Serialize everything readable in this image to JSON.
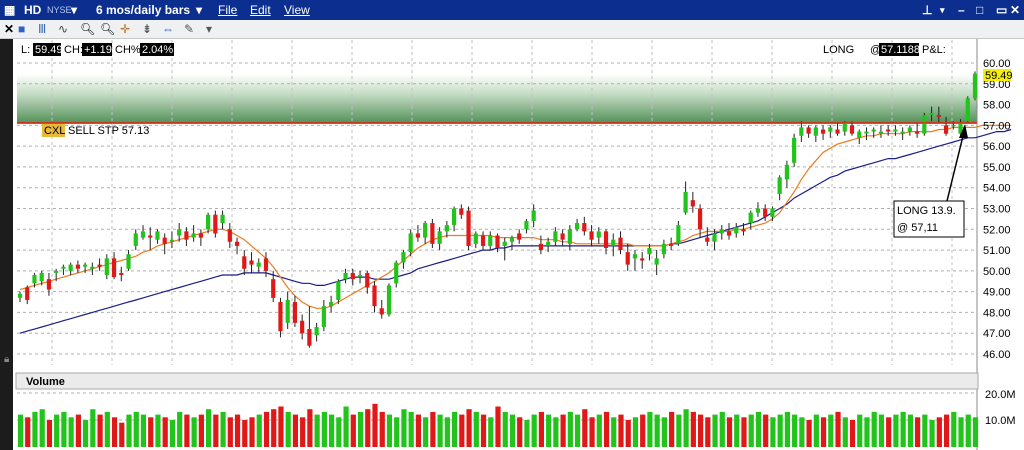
{
  "window": {
    "symbol": "HD",
    "exchange": "NYSE",
    "period": "6 mos/daily bars",
    "menu": [
      "File",
      "Edit",
      "View"
    ],
    "title_icon": "chart-window-icon",
    "controls": [
      "pin-icon",
      "minimize-icon",
      "maximize-icon",
      "close-icon"
    ]
  },
  "toolbar": {
    "icons": [
      "close-icon",
      "info-icon",
      "bar-chart-icon",
      "trend-icon",
      "zoom-in-icon",
      "zoom-out-icon",
      "crosshair-icon",
      "cursor-icon",
      "scroll-icon",
      "wrench-icon",
      "dropdown-icon"
    ]
  },
  "info_bar": {
    "l_label": "L:",
    "l_value": "59.49",
    "ch_label": "CH:",
    "ch_value": "+1.19",
    "chp_label": "CH%:",
    "chp_value": "2.04%",
    "position": "LONG",
    "at_label": "@",
    "avg_price": "57.1188",
    "pl_label": "P&L:"
  },
  "order": {
    "tag": "CXL",
    "text": "SELL STP 57.13",
    "price": 57.13
  },
  "annotation": {
    "line1": "LONG 13.9.",
    "line2": "@ 57,11"
  },
  "volume_panel": {
    "title": "Volume",
    "ticks": [
      "20.0M",
      "10.0M"
    ]
  },
  "colors": {
    "up": "#22c41c",
    "down": "#e01818",
    "neutral": "#f0a020",
    "ma_fast": "#f07a20",
    "ma_slow": "#1a1e88",
    "header": "#0c2f8f"
  },
  "chart_data": {
    "type": "candlestick",
    "y_range": [
      45.6,
      60.6
    ],
    "y_ticks": [
      46.0,
      47.0,
      48.0,
      49.0,
      50.0,
      51.0,
      52.0,
      53.0,
      54.0,
      55.0,
      56.0,
      57.0,
      58.0,
      59.0,
      60.0
    ],
    "last_price": 59.49,
    "ohlc": [
      [
        48.7,
        49.0,
        48.5,
        48.9
      ],
      [
        49.2,
        49.3,
        48.4,
        48.6
      ],
      [
        49.4,
        49.9,
        49.2,
        49.8
      ],
      [
        49.5,
        50.0,
        49.3,
        49.9
      ],
      [
        49.6,
        49.9,
        48.8,
        49.1
      ],
      [
        49.9,
        50.1,
        49.5,
        50.0
      ],
      [
        50.1,
        50.3,
        49.8,
        50.2
      ],
      [
        50.0,
        50.4,
        49.8,
        50.3
      ],
      [
        50.3,
        50.5,
        49.9,
        50.1
      ],
      [
        50.2,
        50.4,
        49.9,
        50.3
      ],
      [
        50.1,
        50.4,
        49.8,
        50.2
      ],
      [
        50.3,
        50.6,
        50.0,
        50.2
      ],
      [
        49.8,
        50.8,
        49.6,
        50.6
      ],
      [
        50.6,
        50.9,
        49.6,
        49.7
      ],
      [
        49.9,
        50.2,
        49.5,
        49.8
      ],
      [
        50.1,
        51.0,
        50.0,
        50.8
      ],
      [
        51.2,
        52.0,
        51.0,
        51.8
      ],
      [
        51.6,
        52.2,
        51.5,
        51.9
      ],
      [
        51.7,
        52.1,
        51.0,
        51.6
      ],
      [
        51.5,
        52.0,
        51.3,
        51.9
      ],
      [
        51.6,
        51.8,
        50.8,
        51.3
      ],
      [
        51.4,
        51.9,
        51.1,
        51.5
      ],
      [
        51.7,
        52.3,
        51.4,
        52.0
      ],
      [
        51.9,
        52.1,
        51.2,
        51.5
      ],
      [
        51.6,
        52.2,
        51.4,
        51.8
      ],
      [
        51.8,
        52.0,
        51.2,
        51.6
      ],
      [
        52.0,
        52.8,
        51.8,
        52.7
      ],
      [
        52.7,
        52.9,
        51.6,
        51.8
      ],
      [
        52.3,
        52.9,
        52.0,
        52.7
      ],
      [
        52.0,
        52.3,
        51.1,
        51.4
      ],
      [
        51.4,
        51.6,
        50.8,
        51.2
      ],
      [
        50.7,
        51.0,
        49.8,
        50.1
      ],
      [
        50.5,
        50.9,
        49.9,
        50.3
      ],
      [
        50.2,
        50.6,
        49.9,
        50.4
      ],
      [
        50.6,
        50.9,
        49.7,
        50.0
      ],
      [
        49.6,
        50.0,
        48.5,
        48.7
      ],
      [
        48.5,
        48.7,
        46.8,
        47.1
      ],
      [
        47.5,
        49.0,
        47.2,
        48.6
      ],
      [
        48.5,
        48.8,
        47.3,
        47.5
      ],
      [
        47.6,
        47.9,
        46.7,
        47.0
      ],
      [
        47.2,
        48.3,
        46.3,
        46.4
      ],
      [
        46.9,
        47.5,
        46.6,
        47.3
      ],
      [
        47.3,
        48.6,
        47.1,
        48.3
      ],
      [
        48.3,
        48.8,
        48.0,
        48.5
      ],
      [
        48.6,
        49.6,
        48.4,
        49.5
      ],
      [
        49.6,
        50.1,
        49.4,
        49.9
      ],
      [
        49.9,
        50.1,
        49.3,
        49.6
      ],
      [
        49.7,
        50.0,
        49.4,
        49.8
      ],
      [
        49.9,
        50.0,
        48.9,
        49.2
      ],
      [
        49.3,
        49.5,
        48.0,
        48.3
      ],
      [
        48.2,
        48.6,
        47.7,
        47.9
      ],
      [
        47.9,
        49.4,
        47.8,
        49.3
      ],
      [
        49.4,
        50.5,
        49.2,
        50.4
      ],
      [
        50.4,
        51.0,
        50.1,
        50.9
      ],
      [
        50.9,
        52.0,
        50.7,
        51.8
      ],
      [
        51.8,
        52.2,
        51.4,
        51.6
      ],
      [
        51.6,
        52.4,
        51.3,
        52.3
      ],
      [
        52.3,
        52.5,
        51.1,
        51.3
      ],
      [
        51.3,
        52.1,
        51.0,
        51.9
      ],
      [
        51.9,
        52.4,
        51.6,
        52.2
      ],
      [
        52.2,
        53.1,
        51.9,
        53.0
      ],
      [
        53.0,
        53.2,
        52.5,
        52.7
      ],
      [
        52.9,
        53.1,
        51.0,
        51.2
      ],
      [
        51.3,
        51.9,
        51.1,
        51.8
      ],
      [
        51.7,
        51.9,
        51.0,
        51.2
      ],
      [
        51.2,
        51.9,
        51.0,
        51.7
      ],
      [
        51.7,
        51.8,
        50.9,
        51.1
      ],
      [
        51.2,
        51.6,
        50.5,
        51.4
      ],
      [
        51.4,
        51.7,
        51.0,
        51.6
      ],
      [
        51.8,
        52.0,
        51.3,
        51.5
      ],
      [
        52.0,
        52.5,
        51.8,
        52.4
      ],
      [
        52.4,
        53.2,
        52.1,
        52.9
      ],
      [
        51.3,
        51.7,
        50.8,
        51.0
      ],
      [
        51.2,
        51.6,
        50.9,
        51.4
      ],
      [
        51.4,
        52.1,
        51.2,
        51.9
      ],
      [
        51.8,
        52.0,
        51.2,
        51.5
      ],
      [
        51.3,
        52.2,
        51.0,
        52.0
      ],
      [
        52.0,
        52.5,
        51.9,
        52.3
      ],
      [
        52.3,
        52.6,
        51.7,
        51.9
      ],
      [
        51.9,
        52.2,
        51.2,
        51.5
      ],
      [
        51.6,
        52.1,
        51.3,
        51.9
      ],
      [
        51.9,
        52.0,
        50.8,
        51.1
      ],
      [
        51.2,
        51.8,
        50.7,
        51.5
      ],
      [
        51.6,
        51.9,
        50.8,
        51.0
      ],
      [
        50.9,
        51.3,
        50.0,
        50.3
      ],
      [
        50.6,
        51.0,
        50.0,
        50.8
      ],
      [
        50.6,
        50.9,
        50.1,
        50.5
      ],
      [
        50.8,
        51.3,
        50.5,
        51.1
      ],
      [
        50.3,
        51.0,
        49.8,
        50.6
      ],
      [
        50.8,
        51.5,
        50.6,
        51.3
      ],
      [
        51.3,
        51.6,
        51.0,
        51.2
      ],
      [
        51.3,
        52.4,
        51.2,
        52.2
      ],
      [
        52.8,
        54.3,
        52.7,
        53.8
      ],
      [
        53.4,
        53.8,
        52.8,
        53.1
      ],
      [
        53.0,
        53.2,
        51.6,
        52.0
      ],
      [
        51.6,
        52.1,
        51.2,
        51.4
      ],
      [
        51.4,
        52.0,
        51.0,
        51.8
      ],
      [
        51.8,
        52.2,
        51.5,
        52.0
      ],
      [
        51.9,
        52.3,
        51.5,
        51.7
      ],
      [
        51.8,
        52.3,
        51.6,
        52.1
      ],
      [
        52.0,
        52.3,
        51.7,
        51.9
      ],
      [
        52.3,
        52.9,
        52.0,
        52.8
      ],
      [
        52.8,
        53.3,
        52.6,
        53.0
      ],
      [
        53.0,
        53.2,
        52.4,
        52.6
      ],
      [
        52.6,
        53.1,
        52.4,
        53.0
      ],
      [
        53.7,
        54.6,
        53.4,
        54.5
      ],
      [
        54.4,
        55.3,
        54.0,
        55.1
      ],
      [
        55.2,
        56.6,
        55.0,
        56.4
      ],
      [
        56.5,
        57.2,
        56.2,
        56.9
      ],
      [
        56.9,
        57.0,
        56.4,
        56.6
      ],
      [
        56.5,
        57.0,
        56.2,
        56.9
      ],
      [
        56.8,
        57.0,
        56.3,
        56.6
      ],
      [
        56.7,
        57.0,
        56.4,
        56.9
      ],
      [
        56.8,
        57.1,
        56.5,
        56.6
      ],
      [
        56.7,
        57.2,
        56.5,
        57.1
      ],
      [
        57.0,
        57.2,
        56.5,
        56.6
      ],
      [
        56.4,
        56.8,
        56.1,
        56.7
      ],
      [
        56.6,
        56.9,
        56.3,
        56.7
      ],
      [
        56.7,
        56.9,
        56.4,
        56.8
      ],
      [
        56.6,
        57.0,
        56.4,
        56.7
      ],
      [
        56.8,
        57.0,
        56.5,
        56.7
      ],
      [
        56.7,
        57.0,
        56.5,
        56.8
      ],
      [
        56.6,
        56.9,
        56.3,
        56.7
      ],
      [
        56.7,
        57.0,
        56.5,
        56.9
      ],
      [
        56.7,
        57.1,
        56.4,
        56.6
      ],
      [
        56.6,
        57.6,
        56.5,
        57.5
      ],
      [
        57.5,
        57.9,
        57.2,
        57.6
      ],
      [
        57.5,
        57.9,
        57.1,
        57.4
      ],
      [
        57.0,
        57.4,
        56.5,
        56.6
      ],
      [
        57.0,
        57.2,
        56.8,
        57.0
      ],
      [
        56.6,
        57.3,
        56.4,
        57.1
      ],
      [
        57.2,
        58.4,
        57.1,
        58.3
      ],
      [
        58.3,
        59.6,
        58.2,
        59.49
      ]
    ],
    "volume_m": [
      12,
      11,
      13,
      14,
      10,
      12,
      13,
      11,
      12,
      10,
      14,
      12,
      13,
      11,
      9,
      12,
      13,
      12,
      11,
      12,
      11,
      10,
      13,
      12,
      11,
      12,
      14,
      12,
      13,
      11,
      12,
      10,
      11,
      12,
      13,
      14,
      15,
      13,
      12,
      11,
      14,
      12,
      13,
      12,
      11,
      15,
      12,
      13,
      14,
      16,
      13,
      12,
      11,
      14,
      13,
      12,
      11,
      13,
      12,
      11,
      13,
      12,
      14,
      13,
      12,
      11,
      15,
      13,
      12,
      11,
      10,
      12,
      13,
      12,
      11,
      12,
      13,
      12,
      14,
      11,
      12,
      13,
      11,
      12,
      10,
      11,
      12,
      13,
      12,
      11,
      13,
      12,
      14,
      13,
      12,
      11,
      12,
      13,
      11,
      12,
      11,
      12,
      13,
      12,
      11,
      12,
      13,
      12,
      11,
      10,
      12,
      11,
      12,
      13,
      11,
      10,
      12,
      11,
      13,
      12,
      11,
      12,
      13,
      12,
      11,
      12,
      10,
      11,
      12,
      13,
      11,
      12,
      11,
      12,
      13,
      12,
      11,
      10
    ],
    "ma_fast": [
      49.1,
      49.2,
      49.3,
      49.4,
      49.5,
      49.6,
      49.7,
      49.8,
      49.9,
      50.0,
      50.1,
      50.2,
      50.3,
      50.4,
      50.5,
      50.6,
      50.7,
      50.9,
      51.0,
      51.2,
      51.3,
      51.4,
      51.5,
      51.6,
      51.7,
      51.8,
      51.9,
      52.0,
      52.0,
      51.9,
      51.7,
      51.5,
      51.2,
      50.9,
      50.6,
      50.2,
      49.7,
      49.2,
      48.8,
      48.5,
      48.3,
      48.2,
      48.2,
      48.3,
      48.5,
      48.7,
      48.9,
      49.1,
      49.3,
      49.5,
      49.7,
      49.9,
      50.2,
      50.5,
      50.8,
      51.1,
      51.3,
      51.5,
      51.6,
      51.7,
      51.7,
      51.7,
      51.7,
      51.7,
      51.7,
      51.7,
      51.6,
      51.6,
      51.6,
      51.6,
      51.6,
      51.6,
      51.5,
      51.5,
      51.5,
      51.4,
      51.4,
      51.3,
      51.3,
      51.3,
      51.3,
      51.3,
      51.3,
      51.3,
      51.3,
      51.2,
      51.2,
      51.2,
      51.2,
      51.2,
      51.3,
      51.4,
      51.5,
      51.7,
      51.8,
      51.9,
      51.9,
      51.9,
      51.9,
      52.0,
      52.0,
      52.1,
      52.2,
      52.3,
      52.5,
      52.8,
      53.3,
      53.8,
      54.4,
      54.9,
      55.3,
      55.7,
      55.9,
      56.1,
      56.2,
      56.3,
      56.4,
      56.5,
      56.5,
      56.6,
      56.6,
      56.6,
      56.6,
      56.7,
      56.7,
      56.7,
      56.7,
      56.8,
      56.8,
      56.9,
      56.9,
      56.9,
      56.9,
      57.0,
      57.0,
      57.0,
      57.0,
      57.0
    ],
    "ma_slow": [
      47.0,
      47.1,
      47.2,
      47.3,
      47.4,
      47.5,
      47.6,
      47.7,
      47.8,
      47.9,
      48.0,
      48.1,
      48.2,
      48.3,
      48.4,
      48.5,
      48.6,
      48.7,
      48.8,
      48.9,
      49.0,
      49.1,
      49.2,
      49.3,
      49.4,
      49.5,
      49.6,
      49.7,
      49.8,
      49.8,
      49.8,
      49.9,
      49.9,
      49.9,
      49.9,
      49.8,
      49.7,
      49.6,
      49.5,
      49.4,
      49.4,
      49.3,
      49.3,
      49.4,
      49.5,
      49.6,
      49.7,
      49.7,
      49.7,
      49.6,
      49.6,
      49.6,
      49.7,
      49.8,
      49.9,
      50.1,
      50.2,
      50.3,
      50.4,
      50.5,
      50.6,
      50.7,
      50.8,
      50.9,
      51.0,
      51.0,
      51.1,
      51.1,
      51.2,
      51.2,
      51.2,
      51.2,
      51.2,
      51.2,
      51.2,
      51.2,
      51.2,
      51.2,
      51.2,
      51.2,
      51.2,
      51.2,
      51.2,
      51.2,
      51.2,
      51.2,
      51.2,
      51.2,
      51.2,
      51.2,
      51.3,
      51.3,
      51.4,
      51.5,
      51.6,
      51.7,
      51.8,
      51.9,
      52.0,
      52.1,
      52.2,
      52.3,
      52.4,
      52.6,
      52.8,
      53.0,
      53.2,
      53.5,
      53.7,
      53.9,
      54.1,
      54.3,
      54.5,
      54.6,
      54.8,
      54.9,
      55.0,
      55.1,
      55.2,
      55.3,
      55.4,
      55.4,
      55.5,
      55.6,
      55.7,
      55.8,
      55.9,
      56.0,
      56.1,
      56.2,
      56.3,
      56.4,
      56.4,
      56.5,
      56.6,
      56.7,
      56.7,
      56.8
    ]
  }
}
